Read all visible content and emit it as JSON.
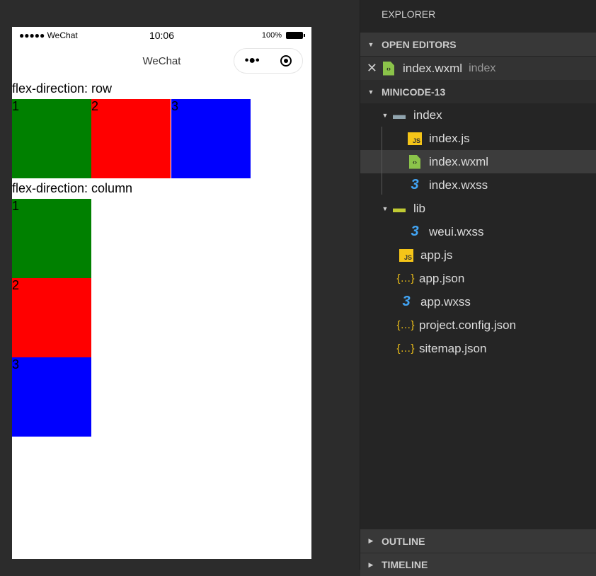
{
  "phone": {
    "carrier": "●●●●● WeChat",
    "time": "10:06",
    "battery": "100%",
    "nav_title": "WeChat",
    "menu_dots": "•●•"
  },
  "content": {
    "row_label": "flex-direction: row",
    "column_label": "flex-direction: column",
    "boxes": [
      {
        "label": "1",
        "color": "#008000"
      },
      {
        "label": "2",
        "color": "#ff0000"
      },
      {
        "label": "3",
        "color": "#0000ff"
      }
    ]
  },
  "explorer": {
    "title": "EXPLORER",
    "open_editors": "OPEN EDITORS",
    "open_file": "index.wxml",
    "open_file_dir": "index",
    "project": "MINICODE-13",
    "tree": [
      "index",
      "index.js",
      "index.wxml",
      "index.wxss",
      "lib",
      "weui.wxss",
      "app.js",
      "app.json",
      "app.wxss",
      "project.config.json",
      "sitemap.json"
    ],
    "outline": "OUTLINE",
    "timeline": "TIMELINE"
  }
}
